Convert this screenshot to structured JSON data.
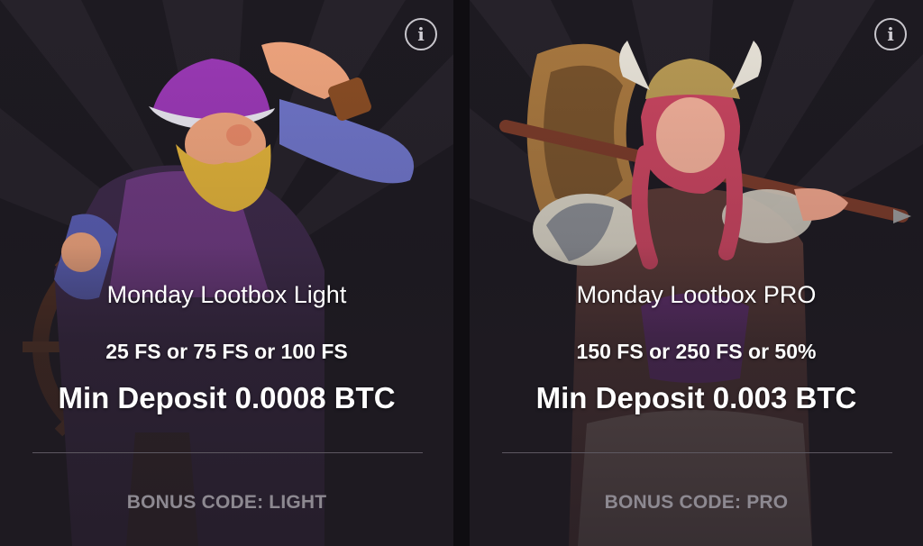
{
  "cards": [
    {
      "title": "Monday Lootbox Light",
      "offer": "25 FS or 75 FS or 100 FS",
      "deposit": "Min Deposit 0.0008 BTC",
      "bonus_code": "BONUS CODE: LIGHT",
      "art": "pirate-captain-illustration"
    },
    {
      "title": "Monday Lootbox PRO",
      "offer": "150 FS or 250 FS or 50%",
      "deposit": "Min Deposit 0.003 BTC",
      "bonus_code": "BONUS CODE: PRO",
      "art": "viking-warrior-illustration"
    }
  ],
  "icons": {
    "info": "info-icon",
    "info_glyph": "i"
  },
  "colors": {
    "background": "#0f0d11",
    "card": "#1f1b22",
    "text": "#ffffff",
    "muted_text": "#8d8991",
    "divider": "#5d5861"
  }
}
